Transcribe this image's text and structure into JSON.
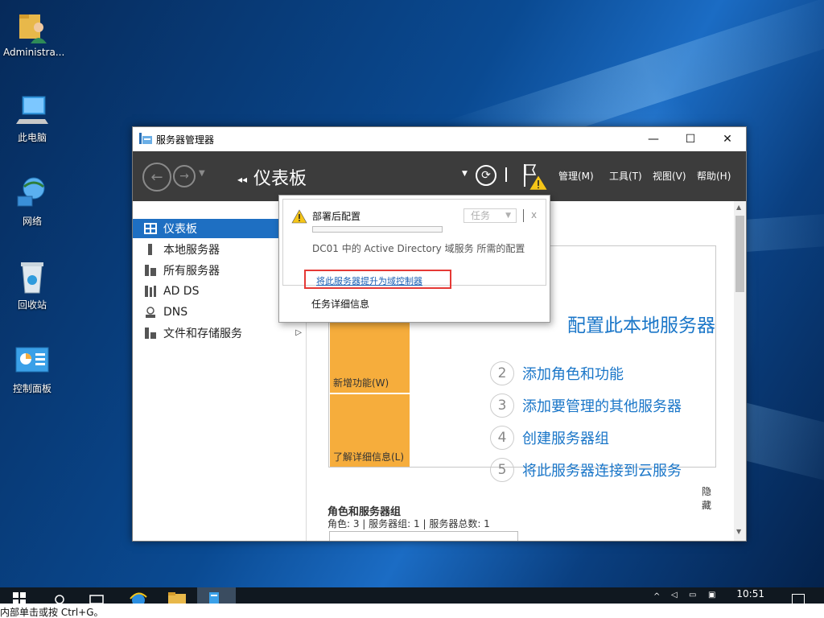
{
  "desktop": {
    "icons": [
      {
        "label": "Administra...",
        "icon": "user-folder-icon"
      },
      {
        "label": "此电脑",
        "icon": "computer-icon"
      },
      {
        "label": "网络",
        "icon": "network-icon"
      },
      {
        "label": "回收站",
        "icon": "recycle-bin-icon"
      },
      {
        "label": "控制面板",
        "icon": "control-panel-icon"
      }
    ]
  },
  "window": {
    "title": "服务器管理器",
    "controls": {
      "minimize": "—",
      "maximize": "☐",
      "close": "✕"
    }
  },
  "toolbar": {
    "breadcrumb": "仪表板",
    "menus": {
      "manage": "管理(M)",
      "tools": "工具(T)",
      "view": "视图(V)",
      "help": "帮助(H)"
    }
  },
  "nav": {
    "items": [
      {
        "label": "仪表板",
        "active": true
      },
      {
        "label": "本地服务器"
      },
      {
        "label": "所有服务器"
      },
      {
        "label": "AD DS"
      },
      {
        "label": "DNS"
      },
      {
        "label": "文件和存储服务"
      }
    ]
  },
  "welcome": {
    "heading": "本地服务器",
    "heading_prefix": "配置此",
    "steps": [
      {
        "num": "2",
        "label": "添加角色和功能"
      },
      {
        "num": "3",
        "label": "添加要管理的其他服务器"
      },
      {
        "num": "4",
        "label": "创建服务器组"
      },
      {
        "num": "5",
        "label": "将此服务器连接到云服务"
      }
    ],
    "tiles": {
      "whats_new": "新增功能(W)",
      "learn_more": "了解详细信息(L)"
    },
    "hide": "隐藏"
  },
  "roles": {
    "title": "角色和服务器组",
    "summary": "角色: 3 | 服务器组: 1 | 服务器总数: 1"
  },
  "popup": {
    "title": "部署后配置",
    "task_button": "任务",
    "close": "x",
    "description": "DC01 中的 Active Directory 域服务 所需的配置",
    "link": "将此服务器提升为域控制器",
    "details": "任务详细信息",
    "progress": 0
  },
  "taskbar": {
    "clock": "10:51"
  },
  "statusbar": {
    "text": "内部单击或按 Ctrl+G。"
  },
  "colors": {
    "toolbar_bg": "#3c3c3c",
    "nav_active": "#1e6fc2",
    "tile_orange": "#f6ad3c",
    "link_blue": "#1a76c8",
    "highlight_red": "#e53935"
  }
}
